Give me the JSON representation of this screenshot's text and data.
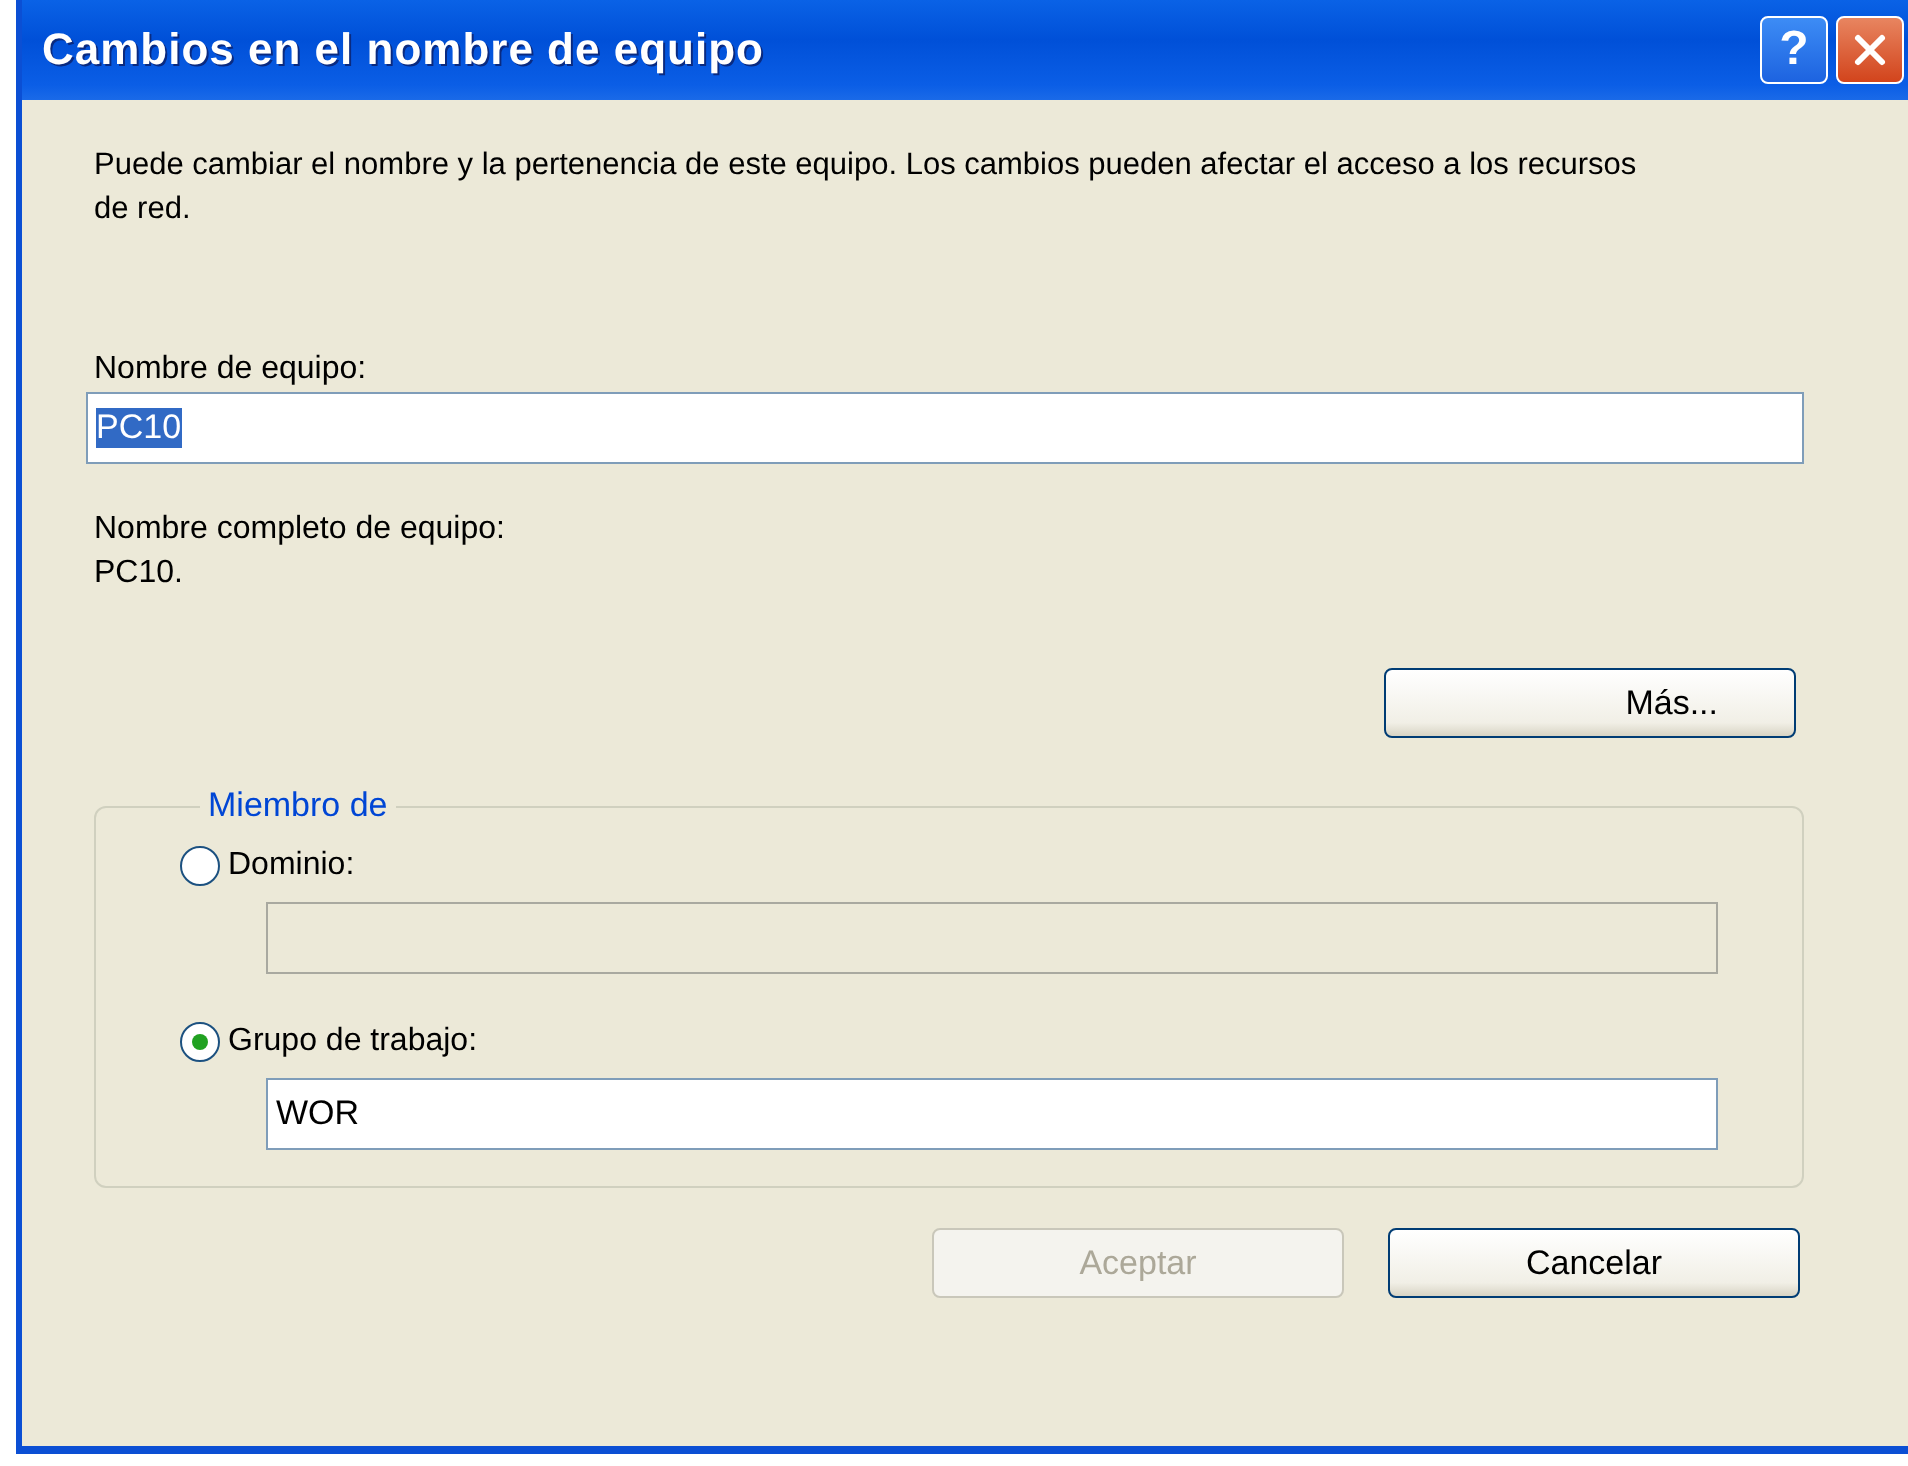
{
  "window": {
    "title": "Cambios en el nombre de equipo",
    "title_buttons": [
      {
        "kind": "help",
        "label": "?"
      },
      {
        "kind": "close"
      }
    ]
  },
  "description": "Puede cambiar el nombre y la pertenencia de este equipo. Los cambios pueden afectar el acceso a los recursos de red.",
  "computer_name": {
    "label": "Nombre de equipo:",
    "value": "PC10",
    "selected": true
  },
  "full_name": {
    "label": "Nombre completo de equipo:",
    "value": "PC10."
  },
  "more_button": {
    "label": "Más..."
  },
  "member_of": {
    "legend": "Miembro de",
    "options": [
      {
        "label": "Dominio:",
        "selected": false,
        "field": {
          "disabled": true
        }
      },
      {
        "label": "Grupo de trabajo:",
        "selected": true,
        "field": {
          "value": "WOR",
          "disabled": false
        }
      }
    ]
  },
  "buttons": [
    {
      "label": "Aceptar",
      "disabled": true
    },
    {
      "label": "Cancelar",
      "disabled": false
    }
  ]
}
